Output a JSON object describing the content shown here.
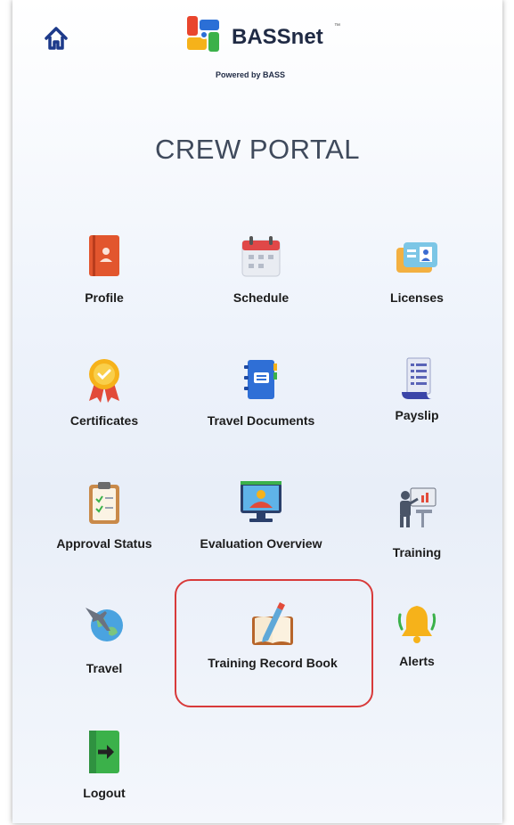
{
  "header": {
    "home_icon": "home-icon",
    "brand_name": "BASSnet",
    "brand_tm": "™",
    "brand_tagline": "Powered by BASS"
  },
  "title": "CREW PORTAL",
  "tiles": {
    "profile": {
      "label": "Profile",
      "icon": "profile-icon"
    },
    "schedule": {
      "label": "Schedule",
      "icon": "calendar-icon"
    },
    "licenses": {
      "label": "Licenses",
      "icon": "id-card-icon"
    },
    "certificates": {
      "label": "Certificates",
      "icon": "medal-icon"
    },
    "travel_documents": {
      "label": "Travel Documents",
      "icon": "document-icon"
    },
    "payslip": {
      "label": "Payslip",
      "icon": "receipt-icon"
    },
    "approval_status": {
      "label": "Approval Status",
      "icon": "clipboard-icon"
    },
    "evaluation_overview": {
      "label": "Evaluation Overview",
      "icon": "presentation-icon"
    },
    "training": {
      "label": "Training",
      "icon": "training-board-icon"
    },
    "travel": {
      "label": "Travel",
      "icon": "globe-plane-icon"
    },
    "training_record_book": {
      "label": "Training Record Book",
      "icon": "book-pencil-icon"
    },
    "alerts": {
      "label": "Alerts",
      "icon": "bell-icon"
    },
    "logout": {
      "label": "Logout",
      "icon": "logout-icon"
    }
  },
  "colors": {
    "highlight": "#d83a3a",
    "title": "#3f4a5c"
  }
}
